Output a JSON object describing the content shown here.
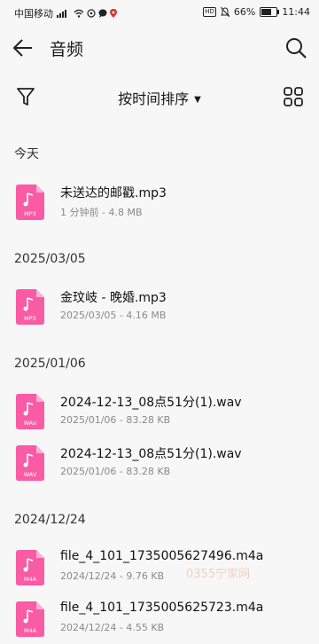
{
  "status_bar": {
    "carrier": "中国移动",
    "battery": "66%",
    "battery_level": 0.66,
    "time": "11:44"
  },
  "header": {
    "title": "音频",
    "back_icon": "back-arrow-icon",
    "search_icon": "search-icon"
  },
  "toolbar": {
    "sort_label": "按时间排序",
    "filter_icon": "filter-icon",
    "grid_icon": "grid-view-icon"
  },
  "colors": {
    "accent": "#f95ba5",
    "background": "#f7f7f7"
  },
  "groups": [
    {
      "label": "今天",
      "items": [
        {
          "name": "未送达的邮戳.mp3",
          "meta": "1 分钟前 - 4.8 MB",
          "type": "MP3"
        }
      ]
    },
    {
      "label": "2025/03/05",
      "items": [
        {
          "name": "金玟岐 - 晚婚.mp3",
          "meta": "2025/03/05 - 4.16 MB",
          "type": "MP3"
        }
      ]
    },
    {
      "label": "2025/01/06",
      "items": [
        {
          "name": "2024-12-13_08点51分(1).wav",
          "meta": "2025/01/06 - 83.28 KB",
          "type": "WAV"
        },
        {
          "name": "2024-12-13_08点51分(1).wav",
          "meta": "2025/01/06 - 83.28 KB",
          "type": "WAV"
        }
      ]
    },
    {
      "label": "2024/12/24",
      "items": [
        {
          "name": "file_4_101_1735005627496.m4a",
          "meta": "2024/12/24 - 9.76 KB",
          "type": "M4A"
        },
        {
          "name": "file_4_101_1735005625723.m4a",
          "meta": "2024/12/24 - 4.55 KB",
          "type": "M4A"
        }
      ]
    }
  ],
  "watermark": "0355宁家网"
}
